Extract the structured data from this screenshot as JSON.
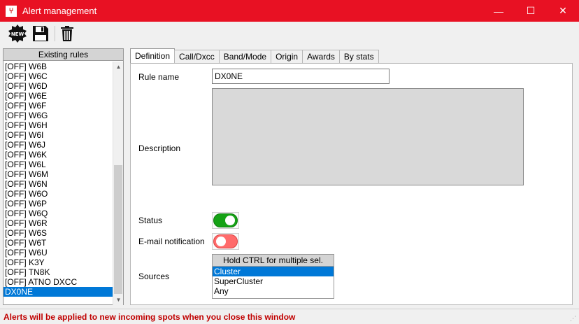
{
  "window": {
    "title": "Alert management",
    "app_icon_glyph": "⑂",
    "minimize_glyph": "—",
    "maximize_glyph": "☐",
    "close_glyph": "✕",
    "accent_color": "#e81123"
  },
  "toolbar": {
    "new_label": "NEW",
    "new_icon": "new-badge-icon",
    "save_icon": "floppy-disk-icon",
    "delete_icon": "trash-icon"
  },
  "rules": {
    "header": "Existing rules",
    "items": [
      "[OFF] W6B",
      "[OFF] W6C",
      "[OFF] W6D",
      "[OFF] W6E",
      "[OFF] W6F",
      "[OFF] W6G",
      "[OFF] W6H",
      "[OFF] W6I",
      "[OFF] W6J",
      "[OFF] W6K",
      "[OFF] W6L",
      "[OFF] W6M",
      "[OFF] W6N",
      "[OFF] W6O",
      "[OFF] W6P",
      "[OFF] W6Q",
      "[OFF] W6R",
      "[OFF] W6S",
      "[OFF] W6T",
      "[OFF] W6U",
      "[OFF] K3Y",
      "[OFF] TN8K",
      "[OFF] ATNO DXCC",
      "DX0NE"
    ],
    "selected_index": 23,
    "scroll_up_glyph": "▲",
    "scroll_down_glyph": "▼"
  },
  "tabs": [
    "Definition",
    "Call/Dxcc",
    "Band/Mode",
    "Origin",
    "Awards",
    "By stats"
  ],
  "active_tab": 0,
  "definition": {
    "rule_name_label": "Rule name",
    "rule_name_value": "DX0NE",
    "description_label": "Description",
    "description_value": "",
    "status_label": "Status",
    "status_on": true,
    "email_label": "E-mail notification",
    "email_on": false,
    "sources_label": "Sources",
    "sources_header": "Hold CTRL for multiple sel.",
    "sources_options": [
      "Cluster",
      "SuperCluster",
      "Any"
    ],
    "sources_selected": 0
  },
  "status_bar": {
    "message": "Alerts will be applied to new incoming spots when you close this window",
    "message_color": "#c00000",
    "grip_glyph": "⋰"
  }
}
